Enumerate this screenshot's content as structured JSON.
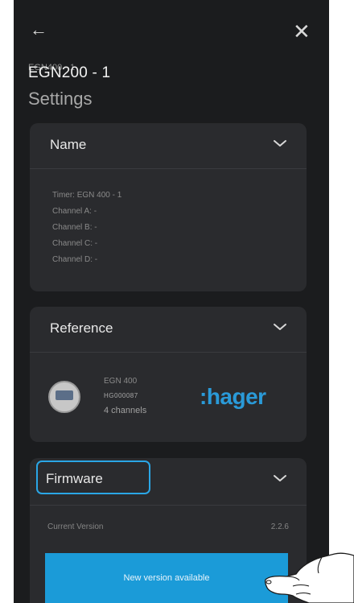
{
  "header": {
    "back_icon": "arrow-left-icon",
    "close_icon": "close-icon",
    "device_name": "EGN200 - 1",
    "device_name_ghost": "EGN400 - 1",
    "title": "Settings"
  },
  "name_card": {
    "title": "Name",
    "lines": [
      "Timer: EGN 400 - 1",
      "Channel A: -",
      "Channel B: -",
      "Channel C: -",
      "Channel D: -"
    ]
  },
  "reference_card": {
    "title": "Reference",
    "product": "EGN 400",
    "code": "HG000087",
    "channels": "4 channels",
    "brand": ":hager"
  },
  "firmware_card": {
    "title": "Firmware",
    "current_version_label": "Current Version",
    "current_version_value": "2.2.6",
    "update_button": "New version available"
  },
  "colors": {
    "background": "#1b1c1e",
    "card": "#2a2b2e",
    "accent": "#1b9bd8",
    "focus": "#2aa6e6"
  }
}
